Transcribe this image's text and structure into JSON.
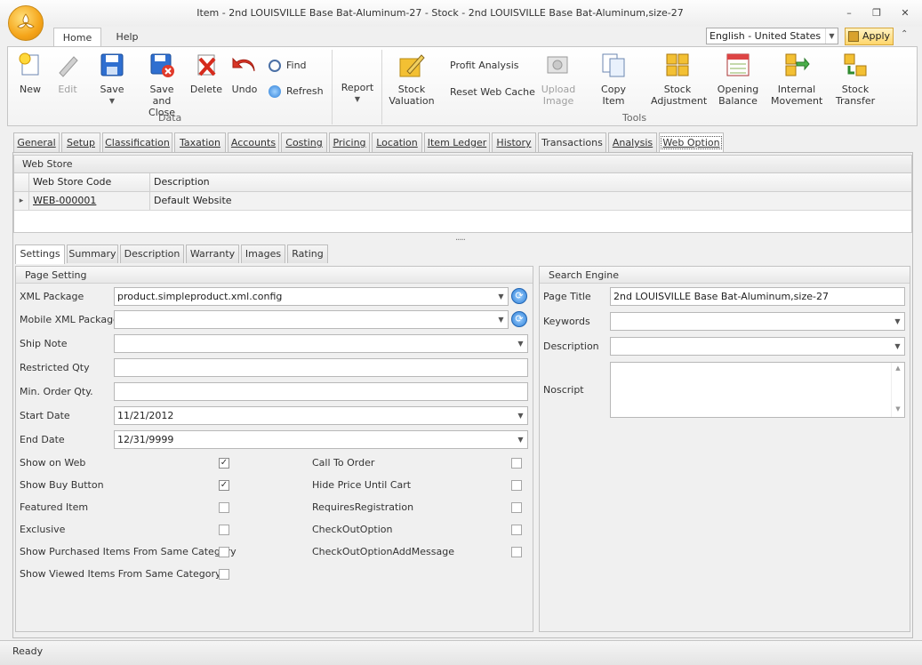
{
  "window": {
    "title": "Item - 2nd LOUISVILLE Base Bat-Aluminum-27 - Stock - 2nd LOUISVILLE Base Bat-Aluminum,size-27",
    "minimize": "–",
    "restore": "❐",
    "close": "✕"
  },
  "ribbon_tabs": [
    "Home",
    "Help"
  ],
  "language": "English - United States",
  "apply_label": "Apply",
  "ribbon": {
    "data_group": "Data",
    "tools_group": "Tools",
    "new": "New",
    "edit": "Edit",
    "save": "Save",
    "save_close_1": "Save and",
    "save_close_2": "Close",
    "delete": "Delete",
    "undo": "Undo",
    "find": "Find",
    "refresh": "Refresh",
    "report": "Report",
    "stock_valuation_1": "Stock",
    "stock_valuation_2": "Valuation",
    "profit_analysis": "Profit Analysis",
    "reset_web_cache": "Reset Web Cache",
    "upload_image_1": "Upload",
    "upload_image_2": "Image",
    "copy_item": "Copy Item",
    "stock_adjustment_1": "Stock",
    "stock_adjustment_2": "Adjustment",
    "opening_balance_1": "Opening",
    "opening_balance_2": "Balance",
    "internal_movement_1": "Internal",
    "internal_movement_2": "Movement",
    "stock_transfer_1": "Stock",
    "stock_transfer_2": "Transfer"
  },
  "doc_tabs": [
    "General",
    "Setup",
    "Classification",
    "Taxation",
    "Accounts",
    "Costing",
    "Pricing",
    "Location",
    "Item Ledger",
    "History",
    "Transactions",
    "Analysis",
    "Web Option"
  ],
  "web_store": {
    "header": "Web Store",
    "col_code": "Web Store Code",
    "col_desc": "Description",
    "rows": [
      {
        "code": "WEB-000001",
        "desc": "Default Website"
      }
    ],
    "splitter": "....."
  },
  "sub_tabs": [
    "Settings",
    "Summary",
    "Description",
    "Warranty",
    "Images",
    "Rating"
  ],
  "page_setting": {
    "header": "Page Setting",
    "xml_package_label": "XML Package",
    "xml_package_value": "product.simpleproduct.xml.config",
    "mobile_xml_label": "Mobile XML Package",
    "mobile_xml_value": "",
    "ship_note_label": "Ship Note",
    "ship_note_value": "",
    "restricted_qty_label": "Restricted Qty",
    "restricted_qty_value": "",
    "min_order_label": "Min. Order Qty.",
    "min_order_value": "",
    "start_date_label": "Start Date",
    "start_date_value": "11/21/2012",
    "end_date_label": "End Date",
    "end_date_value": "12/31/9999",
    "checks_left": [
      {
        "label": "Show on Web",
        "checked": true
      },
      {
        "label": "Show Buy Button",
        "checked": true
      },
      {
        "label": "Featured Item",
        "checked": false
      },
      {
        "label": "Exclusive",
        "checked": false
      },
      {
        "label": "Show Purchased Items From Same Category",
        "checked": false
      },
      {
        "label": "Show Viewed Items From Same Category",
        "checked": false
      }
    ],
    "checks_right": [
      {
        "label": "Call To Order",
        "checked": false
      },
      {
        "label": "Hide Price Until Cart",
        "checked": false
      },
      {
        "label": "RequiresRegistration",
        "checked": false
      },
      {
        "label": "CheckOutOption",
        "checked": false
      },
      {
        "label": "CheckOutOptionAddMessage",
        "checked": false
      }
    ]
  },
  "search_engine": {
    "header": "Search Engine",
    "page_title_label": "Page Title",
    "page_title_value": "2nd LOUISVILLE Base Bat-Aluminum,size-27",
    "keywords_label": "Keywords",
    "keywords_value": "",
    "description_label": "Description",
    "description_value": "",
    "noscript_label": "Noscript",
    "noscript_value": ""
  },
  "status": "Ready",
  "check_glyph": "✓",
  "dropdown_glyph": "▼",
  "refresh_glyph": "⟳",
  "row_indicator": "▸",
  "icons": [
    "app-orb-icon",
    "new-icon",
    "edit-icon",
    "save-icon",
    "save-close-icon",
    "delete-icon",
    "undo-icon",
    "find-icon",
    "refresh-icon",
    "stock-valuation-icon",
    "upload-image-icon",
    "copy-item-icon",
    "stock-adjustment-icon",
    "opening-balance-icon",
    "internal-movement-icon",
    "stock-transfer-icon"
  ]
}
